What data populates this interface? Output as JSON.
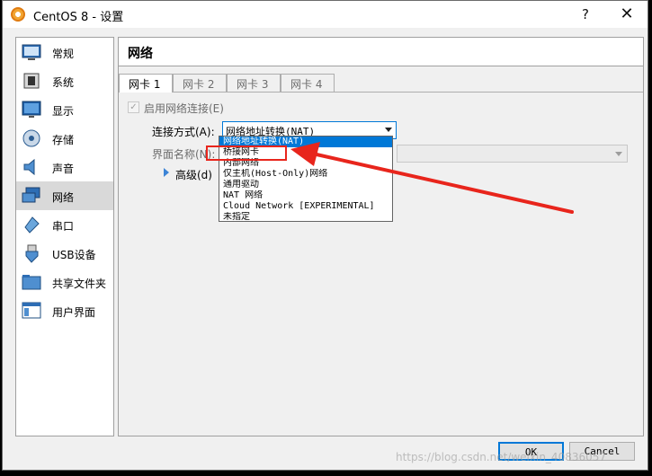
{
  "window": {
    "title": "CentOS 8 - 设置",
    "help": "?",
    "close": "✕"
  },
  "sidebar": {
    "items": [
      {
        "label": "常规",
        "icon": "general-icon"
      },
      {
        "label": "系统",
        "icon": "system-icon"
      },
      {
        "label": "显示",
        "icon": "display-icon"
      },
      {
        "label": "存储",
        "icon": "storage-icon"
      },
      {
        "label": "声音",
        "icon": "audio-icon"
      },
      {
        "label": "网络",
        "icon": "network-icon",
        "selected": true
      },
      {
        "label": "串口",
        "icon": "serial-port-icon"
      },
      {
        "label": "USB设备",
        "icon": "usb-icon"
      },
      {
        "label": "共享文件夹",
        "icon": "shared-folder-icon"
      },
      {
        "label": "用户界面",
        "icon": "user-interface-icon"
      }
    ]
  },
  "main": {
    "title": "网络",
    "tabs": [
      "网卡 1",
      "网卡 2",
      "网卡 3",
      "网卡 4"
    ],
    "enable_label": "启用网络连接(E)",
    "attached_label": "连接方式(A):",
    "attached_value": "网络地址转换(NAT)",
    "name_label": "界面名称(N):",
    "advanced_label": "高级(d)"
  },
  "dropdown": {
    "options": [
      "网络地址转换(NAT)",
      "桥接网卡",
      "内部网络",
      "仅主机(Host-Only)网络",
      "通用驱动",
      "NAT 网络",
      "Cloud Network [EXPERIMENTAL]",
      "未指定"
    ]
  },
  "buttons": {
    "ok": "OK",
    "cancel": "Cancel"
  },
  "watermark": "https://blog.csdn.net/weixin_40836057",
  "colors": {
    "accent": "#0078d7",
    "annotation": "#e8251c"
  }
}
